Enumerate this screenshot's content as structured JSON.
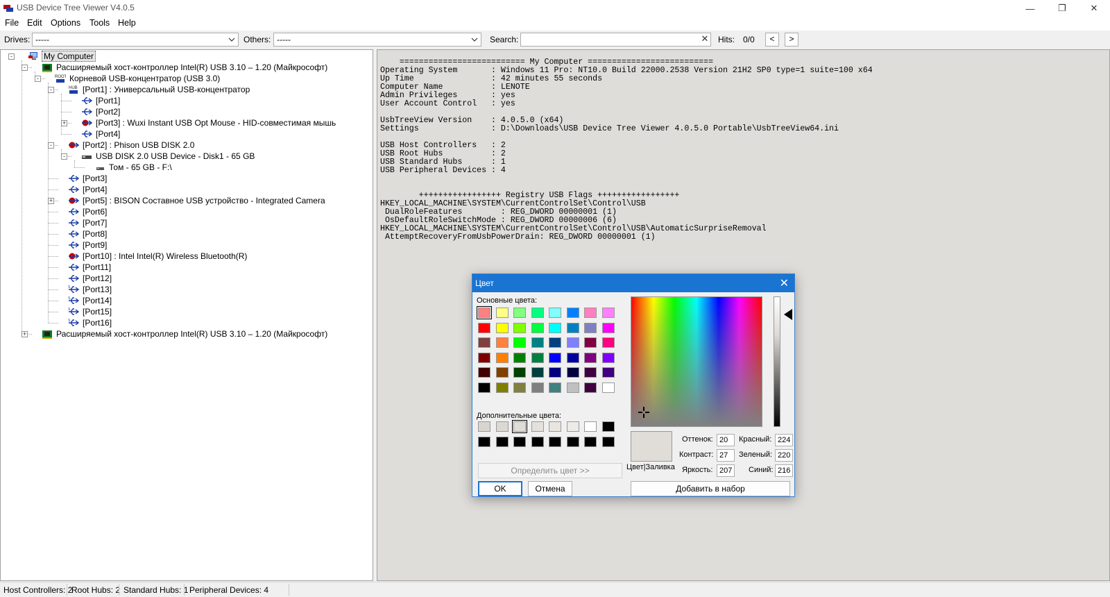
{
  "window": {
    "title": "USB Device Tree Viewer V4.0.5",
    "controls": {
      "minimize": "—",
      "maximize": "❐",
      "close": "✕"
    }
  },
  "menu": [
    "File",
    "Edit",
    "Options",
    "Tools",
    "Help"
  ],
  "toolbar": {
    "drives_label": "Drives:",
    "drives_value": "-----",
    "others_label": "Others:",
    "others_value": "-----",
    "search_label": "Search:",
    "search_value": "",
    "hits_label": "Hits:",
    "hits_value": "0/0",
    "prev": "<",
    "next": ">"
  },
  "tree": [
    {
      "text": "My Computer",
      "icon": "computer-icon",
      "level": 0,
      "expander": "-",
      "selected": true
    },
    {
      "text": "Расширяемый хост-контроллер Intel(R) USB 3.10 – 1.20 (Майкрософт)",
      "icon": "host-controller-icon",
      "level": 1,
      "expander": "-"
    },
    {
      "text": "Корневой USB-концентратор (USB 3.0)",
      "icon": "root-hub-icon",
      "level": 2,
      "expander": "-"
    },
    {
      "text": "[Port1] : Универсальный USB-концентратор",
      "icon": "hub-icon",
      "level": 3,
      "expander": "-"
    },
    {
      "text": "[Port1]",
      "icon": "usb-port-icon",
      "level": 4
    },
    {
      "text": "[Port2]",
      "icon": "usb-port-icon",
      "level": 4
    },
    {
      "text": "[Port3] : Wuxi Instant USB Opt Mouse - HID-совместимая мышь",
      "icon": "usb-device-icon",
      "level": 4,
      "expander": "+"
    },
    {
      "text": "[Port4]",
      "icon": "usb-port-icon",
      "level": 4
    },
    {
      "text": "[Port2] : Phison USB DISK 2.0",
      "icon": "usb-device-icon",
      "level": 3,
      "expander": "-"
    },
    {
      "text": "USB DISK 2.0 USB Device - Disk1 - 65 GB",
      "icon": "disk-icon",
      "level": 4,
      "expander": "-"
    },
    {
      "text": "Том - 65 GB - F:\\",
      "icon": "volume-icon",
      "level": 5
    },
    {
      "text": "[Port3]",
      "icon": "usb-port-icon",
      "level": 3
    },
    {
      "text": "[Port4]",
      "icon": "usb-port-icon",
      "level": 3
    },
    {
      "text": "[Port5] : BISON Составное USB устройство - Integrated Camera",
      "icon": "usb-device-icon",
      "level": 3,
      "expander": "+"
    },
    {
      "text": "[Port6]",
      "icon": "usb-port-icon",
      "level": 3
    },
    {
      "text": "[Port7]",
      "icon": "usb-port-icon",
      "level": 3
    },
    {
      "text": "[Port8]",
      "icon": "usb-port-icon",
      "level": 3
    },
    {
      "text": "[Port9]",
      "icon": "usb-port-icon",
      "level": 3
    },
    {
      "text": "[Port10] : Intel Intel(R) Wireless Bluetooth(R)",
      "icon": "usb-device-icon",
      "level": 3
    },
    {
      "text": "[Port11]",
      "icon": "usb-port-icon",
      "level": 3
    },
    {
      "text": "[Port12]",
      "icon": "usb-port-icon",
      "level": 3
    },
    {
      "text": "[Port13]",
      "icon": "usb-port-ss-icon",
      "level": 3
    },
    {
      "text": "[Port14]",
      "icon": "usb-port-ss-icon",
      "level": 3
    },
    {
      "text": "[Port15]",
      "icon": "usb-port-ss-icon",
      "level": 3
    },
    {
      "text": "[Port16]",
      "icon": "usb-port-ss-icon",
      "level": 3
    },
    {
      "text": "Расширяемый хост-контроллер Intel(R) USB 3.10 – 1.20 (Майкрософт)",
      "icon": "host-controller-icon",
      "level": 1,
      "expander": "+"
    }
  ],
  "info_text": "    ========================== My Computer ==========================\nOperating System       : Windows 11 Pro: NT10.0 Build 22000.2538 Version 21H2 SP0 type=1 suite=100 x64\nUp Time                : 42 minutes 55 seconds\nComputer Name          : LENOTE\nAdmin Privileges       : yes\nUser Account Control   : yes\n\nUsbTreeView Version    : 4.0.5.0 (x64)\nSettings               : D:\\Downloads\\USB Device Tree Viewer 4.0.5.0 Portable\\UsbTreeView64.ini\n\nUSB Host Controllers   : 2\nUSB Root Hubs          : 2\nUSB Standard Hubs      : 1\nUSB Peripheral Devices : 4\n\n\n        +++++++++++++++++ Registry USB Flags +++++++++++++++++\nHKEY_LOCAL_MACHINE\\SYSTEM\\CurrentControlSet\\Control\\USB\n DualRoleFeatures        : REG_DWORD 00000001 (1)\n OsDefaultRoleSwitchMode : REG_DWORD 00000006 (6)\nHKEY_LOCAL_MACHINE\\SYSTEM\\CurrentControlSet\\Control\\USB\\AutomaticSurpriseRemoval\n AttemptRecoveryFromUsbPowerDrain: REG_DWORD 00000001 (1)",
  "statusbar": [
    "Host Controllers: 2",
    "Root Hubs: 2",
    "Standard Hubs: 1",
    "Peripheral Devices: 4"
  ],
  "color_dialog": {
    "title": "Цвет",
    "close": "✕",
    "basic_colors_label": "Основные цвета:",
    "basic_colors": [
      "#ff8080",
      "#ffff80",
      "#80ff80",
      "#00ff80",
      "#80ffff",
      "#0080ff",
      "#ff80c0",
      "#ff80ff",
      "#ff0000",
      "#ffff00",
      "#80ff00",
      "#00ff40",
      "#00ffff",
      "#0080c0",
      "#8080c0",
      "#ff00ff",
      "#804040",
      "#ff8040",
      "#00ff00",
      "#008080",
      "#004080",
      "#8080ff",
      "#800040",
      "#ff0080",
      "#800000",
      "#ff8000",
      "#008000",
      "#008040",
      "#0000ff",
      "#0000a0",
      "#800080",
      "#8000ff",
      "#400000",
      "#804000",
      "#004000",
      "#004040",
      "#000080",
      "#000040",
      "#400040",
      "#400080",
      "#000000",
      "#808000",
      "#808040",
      "#808080",
      "#408080",
      "#c0c0c0",
      "#400040",
      "#ffffff"
    ],
    "custom_colors_label": "Дополнительные цвета:",
    "custom_colors": [
      "#d8d4d0",
      "#dcd8d4",
      "#e0dcd8",
      "#e4e0dc",
      "#e8e4e0",
      "#ecebe8",
      "#ffffff",
      "#000000",
      "#000000",
      "#000000",
      "#000000",
      "#000000",
      "#000000",
      "#000000",
      "#000000",
      "#000000"
    ],
    "define_button": "Определить цвет >>",
    "ok_button": "OK",
    "cancel_button": "Отмена",
    "add_button": "Добавить в набор",
    "solid_label": "Цвет|Заливка",
    "hue_label": "Оттенок:",
    "hue_value": "20",
    "sat_label": "Контраст:",
    "sat_value": "27",
    "lum_label": "Яркость:",
    "lum_value": "207",
    "red_label": "Красный:",
    "red_value": "224",
    "green_label": "Зеленый:",
    "green_value": "220",
    "blue_label": "Синий:",
    "blue_value": "216"
  }
}
